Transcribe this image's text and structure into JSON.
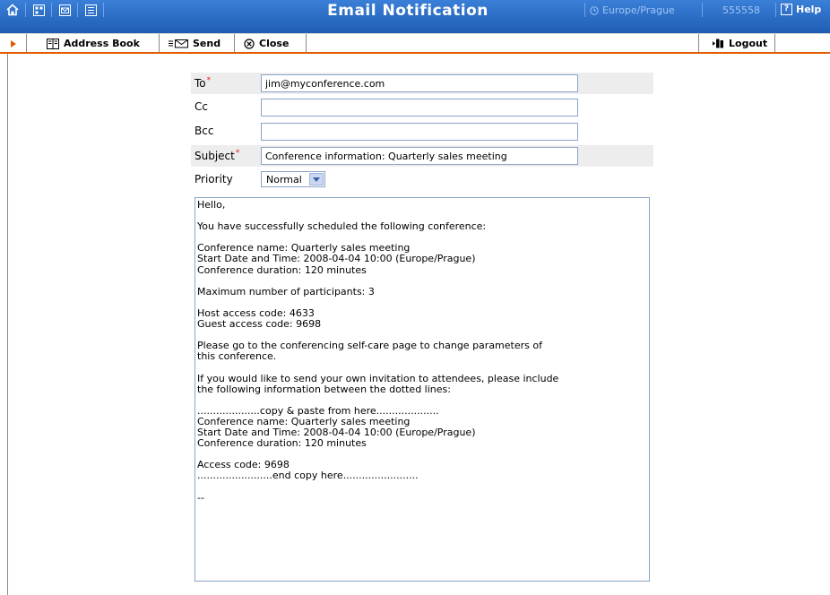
{
  "header": {
    "title": "Email Notification",
    "timezone": "Europe/Prague",
    "account": "555558",
    "help": "Help",
    "icons": [
      "home-icon",
      "grid-icon",
      "mail-icon",
      "list-icon",
      "clock-icon",
      "help-icon"
    ],
    "colors": {
      "bar": "#2c6cc4",
      "muted_text": "#9fc4f5",
      "accent": "#e05a00"
    }
  },
  "toolbar": {
    "address_book": "Address Book",
    "send": "Send",
    "close": "Close",
    "logout": "Logout"
  },
  "form": {
    "to_label": "To",
    "to_value": "jim@myconference.com",
    "cc_label": "Cc",
    "cc_value": "",
    "bcc_label": "Bcc",
    "bcc_value": "",
    "subject_label": "Subject",
    "subject_value": "Conference information: Quarterly sales meeting",
    "priority_label": "Priority",
    "priority_value": "Normal",
    "required_mark": "*",
    "body": "Hello,\n\nYou have successfully scheduled the following conference:\n\nConference name: Quarterly sales meeting\nStart Date and Time: 2008-04-04 10:00 (Europe/Prague)\nConference duration: 120 minutes\n\nMaximum number of participants: 3\n\nHost access code: 4633\nGuest access code: 9698\n\nPlease go to the conferencing self-care page to change parameters of\nthis conference.\n\nIf you would like to send your own invitation to attendees, please include\nthe following information between the dotted lines:\n\n....................copy & paste from here....................\nConference name: Quarterly sales meeting\nStart Date and Time: 2008-04-04 10:00 (Europe/Prague)\nConference duration: 120 minutes\n\nAccess code: 9698\n........................end copy here........................\n\n--"
  }
}
